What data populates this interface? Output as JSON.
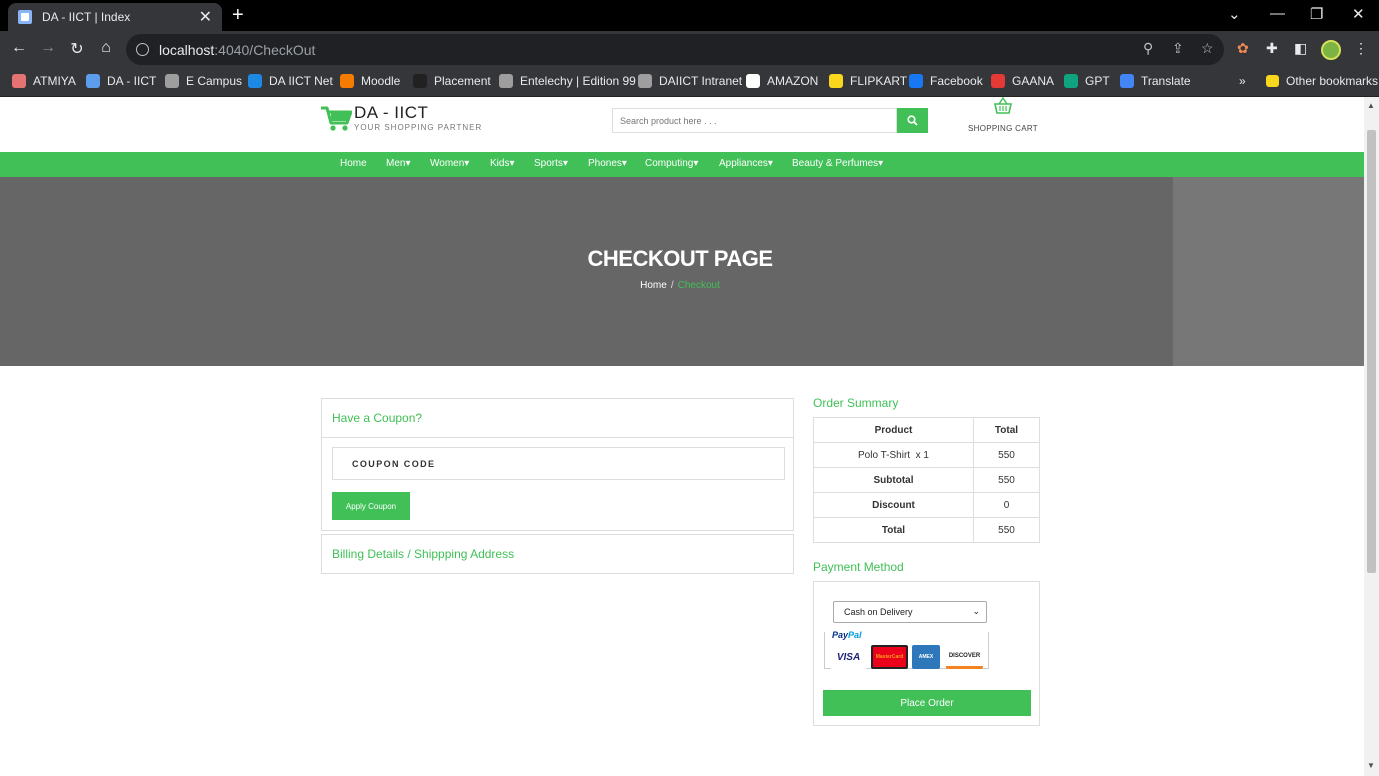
{
  "browser": {
    "tab_title": "DA - IICT | Index",
    "url_host": "localhost",
    "url_path": ":4040/CheckOut",
    "bookmarks": [
      {
        "label": "ATMIYA",
        "icon": "atmiya-icon",
        "color": "#e57373"
      },
      {
        "label": "DA - IICT",
        "icon": "daiict-icon",
        "color": "#5c9ded"
      },
      {
        "label": "E Campus",
        "icon": "globe-icon",
        "color": "#9e9e9e"
      },
      {
        "label": "DA IICT Net",
        "icon": "s-icon",
        "color": "#1e88e5"
      },
      {
        "label": "Moodle",
        "icon": "moodle-icon",
        "color": "#f57c00"
      },
      {
        "label": "Placement",
        "icon": "bowtie-icon",
        "color": "#212121"
      },
      {
        "label": "Entelechy | Edition 99",
        "icon": "globe-icon",
        "color": "#9e9e9e"
      },
      {
        "label": "DAIICT Intranet",
        "icon": "globe-icon",
        "color": "#9e9e9e"
      },
      {
        "label": "AMAZON",
        "icon": "amazon-icon",
        "color": "#ffffff"
      },
      {
        "label": "FLIPKART",
        "icon": "flipkart-icon",
        "color": "#f9d71c"
      },
      {
        "label": "Facebook",
        "icon": "facebook-icon",
        "color": "#1877f2"
      },
      {
        "label": "GAANA",
        "icon": "gaana-icon",
        "color": "#e53935"
      },
      {
        "label": "GPT",
        "icon": "gpt-icon",
        "color": "#10a37f"
      },
      {
        "label": "Translate",
        "icon": "translate-icon",
        "color": "#4285f4"
      }
    ],
    "other_bookmarks": "Other bookmarks"
  },
  "site": {
    "brand_name": "DA - IICT",
    "tagline": "YOUR SHOPPING PARTNER",
    "search_placeholder": "Search product here . . .",
    "cart_label": "SHOPPING CART",
    "accent": "#40c057",
    "menu": [
      "Home",
      "Men",
      "Women",
      "Kids",
      "Sports",
      "Phones",
      "Computing",
      "Appliances",
      "Beauty & Perfumes"
    ]
  },
  "hero": {
    "title": "CHECKOUT PAGE",
    "crumb_home": "Home",
    "crumb_sep": "/",
    "crumb_current": "Checkout"
  },
  "coupon": {
    "heading": "Have a Coupon?",
    "placeholder": "COUPON CODE",
    "apply_label": "Apply Coupon"
  },
  "billing": {
    "heading": "Billing Details / Shippping Address"
  },
  "order_summary": {
    "heading": "Order Summary",
    "col_product": "Product",
    "col_total": "Total",
    "item_name": "Polo T-Shirt",
    "item_qty": "x 1",
    "item_total": "550",
    "subtotal_label": "Subtotal",
    "subtotal": "550",
    "discount_label": "Discount",
    "discount": "0",
    "total_label": "Total",
    "total": "550"
  },
  "payment": {
    "heading": "Payment Method",
    "selected": "Cash on Delivery",
    "paypal_1": "Pay",
    "paypal_2": "Pal",
    "cards": [
      "VISA",
      "MasterCard",
      "AMEX",
      "DISCOVER"
    ],
    "place_order": "Place Order"
  }
}
